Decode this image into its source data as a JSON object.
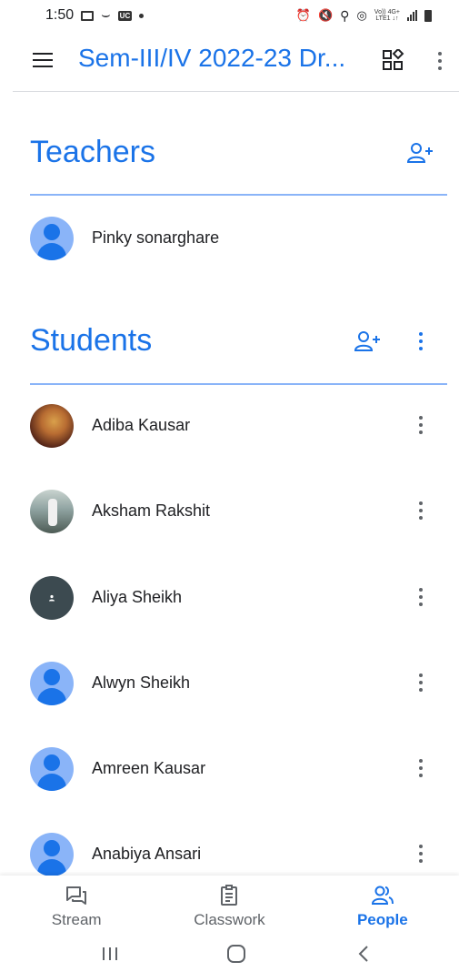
{
  "status_bar": {
    "time": "1:50",
    "network_label_top": "Vo)) 4G+",
    "network_label_bottom": "LTE1 ↓↑"
  },
  "app_bar": {
    "title": "Sem-III/IV 2022-23 Dr...",
    "menu_icon": "menu-icon",
    "apps_icon": "apps-icon",
    "more_icon": "more-vert-icon"
  },
  "teachers": {
    "title": "Teachers",
    "add_icon": "person-add-icon",
    "people": [
      {
        "name": "Pinky sonarghare",
        "avatar": "default"
      }
    ]
  },
  "students": {
    "title": "Students",
    "add_icon": "person-add-icon",
    "people": [
      {
        "name": "Adiba Kausar",
        "avatar": "photo"
      },
      {
        "name": "Aksham Rakshit",
        "avatar": "photo"
      },
      {
        "name": "Aliya Sheikh",
        "avatar": "dark"
      },
      {
        "name": "Alwyn Sheikh",
        "avatar": "default"
      },
      {
        "name": "Amreen Kausar",
        "avatar": "default"
      },
      {
        "name": "Anabiya Ansari",
        "avatar": "default"
      }
    ]
  },
  "bottom_nav": {
    "items": [
      {
        "label": "Stream",
        "icon": "stream-icon",
        "active": false
      },
      {
        "label": "Classwork",
        "icon": "classwork-icon",
        "active": false
      },
      {
        "label": "People",
        "icon": "people-icon",
        "active": true
      }
    ]
  },
  "colors": {
    "accent": "#1a73e8",
    "rule": "#8ab4f8",
    "text": "#202124",
    "muted": "#5f6368"
  }
}
